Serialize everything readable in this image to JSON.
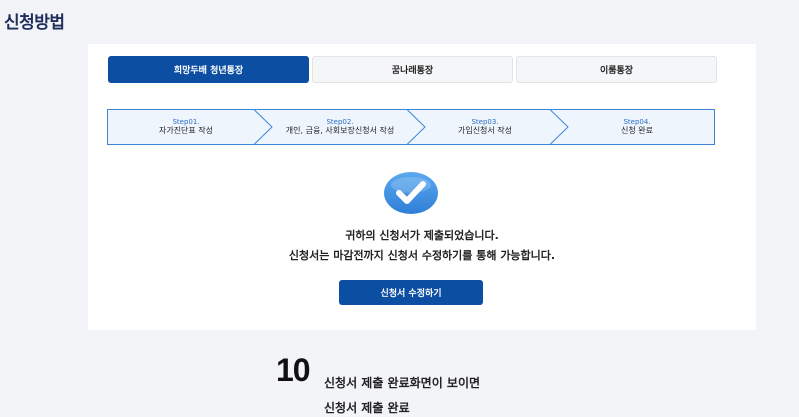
{
  "section": {
    "title": "신청방법"
  },
  "tabs": [
    {
      "label": "희망두배 청년통장",
      "active": true
    },
    {
      "label": "꿈나래통장",
      "active": false
    },
    {
      "label": "이룸통장",
      "active": false
    }
  ],
  "steps": [
    {
      "num": "Step01.",
      "name": "자가진단표 작성"
    },
    {
      "num": "Step02.",
      "name": "개인, 금융, 사회보장신청서 작성"
    },
    {
      "num": "Step03.",
      "name": "가입신청서 작성"
    },
    {
      "num": "Step04.",
      "name": "신청 완료"
    }
  ],
  "message": {
    "line1": "귀하의 신청서가 제출되었습니다.",
    "line2": "신청서는 마감전까지 신청서 수정하기를 통해 가능합니다."
  },
  "edit_button": {
    "label": "신청서 수정하기"
  },
  "footer": {
    "number": "10",
    "line1": "신청서 제출 완료화면이 보이면",
    "line2": "신청서 제출 완료"
  },
  "colors": {
    "primary": "#0c4ea2",
    "step_bg": "#eef5fd",
    "step_border": "#3d86d6",
    "check": "#3b8fe0"
  },
  "icons": {
    "complete": "check-circle-icon"
  }
}
